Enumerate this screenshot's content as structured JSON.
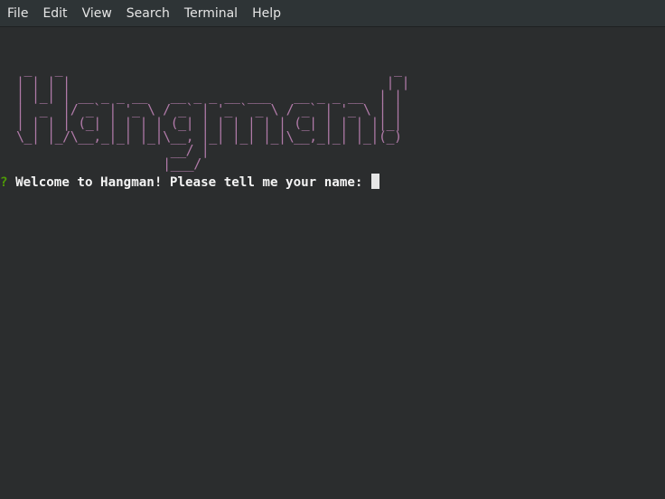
{
  "menubar": {
    "items": [
      {
        "label": "File"
      },
      {
        "label": "Edit"
      },
      {
        "label": "View"
      },
      {
        "label": "Search"
      },
      {
        "label": "Terminal"
      },
      {
        "label": "Help"
      }
    ]
  },
  "terminal": {
    "banner": " _   _                                           _ \n| | | |                                         | |\n| |_| | __ _ _ __   __ _ _ __ ___   __ _ _ __  | |\n|  _  |/ _` | '_ \\ / _` | '_ ` _ \\ / _` | '_ \\ | |\n| | | | (_| | | | | (_| | | | | | | (_| | | | ||_|\n\\_| |_/\\__,_|_| |_|\\__, |_| |_| |_|\\__,_|_| |_|(_)\n                    __/ |                          \n                   |___/                           ",
    "prompt_symbol": "?",
    "prompt_text": "Welcome to Hangman! Please tell me your name:",
    "input_value": ""
  },
  "colors": {
    "background": "#2b2d2e",
    "banner": "#b07aa8",
    "prompt_symbol": "#4e9a06",
    "text": "#f4f4f4"
  }
}
